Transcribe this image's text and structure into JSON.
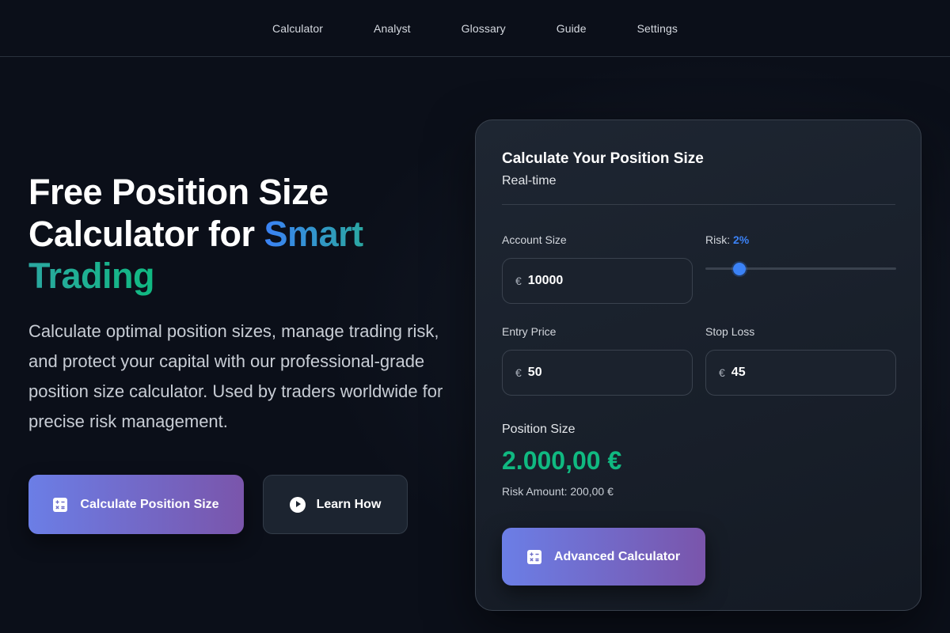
{
  "nav": {
    "items": [
      {
        "label": "Calculator"
      },
      {
        "label": "Analyst"
      },
      {
        "label": "Glossary"
      },
      {
        "label": "Guide"
      },
      {
        "label": "Settings"
      }
    ]
  },
  "hero": {
    "title_line1": "Free Position Size",
    "title_line2_plain": "Calculator for ",
    "title_highlight": "Smart Trading",
    "description": "Calculate optimal position sizes, manage trading risk, and protect your capital with our professional-grade position size calculator. Used by traders worldwide for precise risk management.",
    "primary_button": "Calculate Position Size",
    "secondary_button": "Learn How"
  },
  "calculator": {
    "title": "Calculate Your Position Size",
    "subtitle": "Real-time",
    "account_size_label": "Account Size",
    "account_size_currency": "€",
    "account_size_value": "10000",
    "risk_label": "Risk:",
    "risk_value": "2%",
    "risk_slider_fraction": 0.18,
    "entry_price_label": "Entry Price",
    "entry_price_currency": "€",
    "entry_price_value": "50",
    "stop_loss_label": "Stop Loss",
    "stop_loss_currency": "€",
    "stop_loss_value": "45",
    "position_size_label": "Position Size",
    "position_size_value": "2.000,00 €",
    "risk_amount_text": "Risk Amount: 200,00 €",
    "advanced_button": "Advanced Calculator"
  },
  "colors": {
    "accent_blue": "#3b82f6",
    "accent_green": "#10b981",
    "button_gradient_start": "#6b7ee6",
    "button_gradient_end": "#7a55ab"
  },
  "icons": {
    "primary_button_icon": "calculator-icon",
    "secondary_button_icon": "play-circle-icon",
    "advanced_button_icon": "calculator-icon"
  }
}
